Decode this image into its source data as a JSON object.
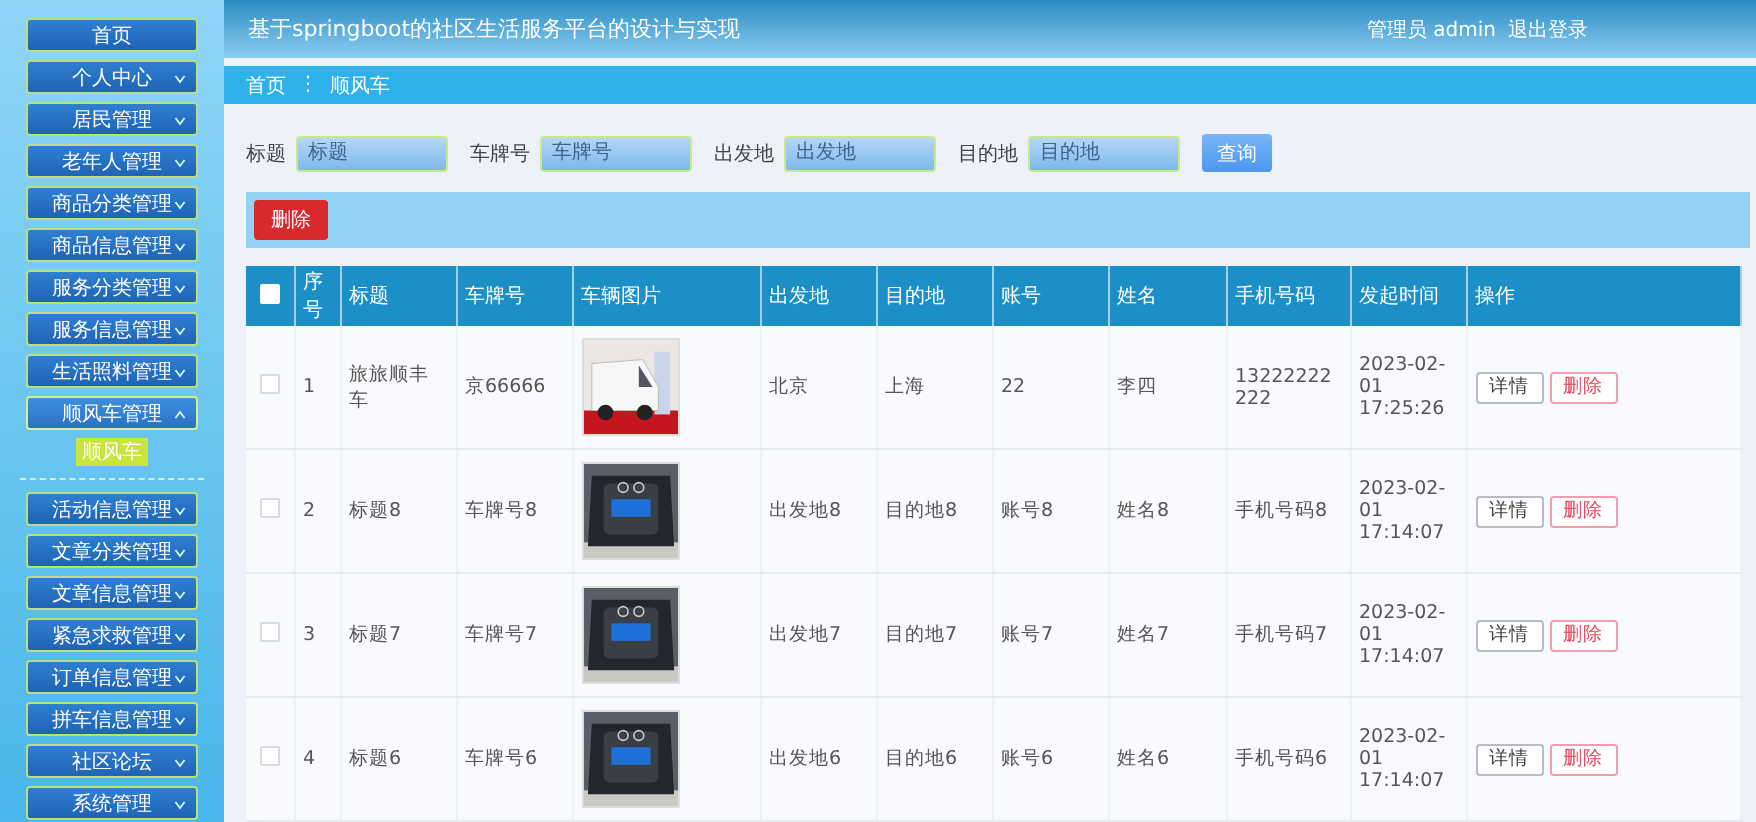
{
  "header": {
    "title": "基于springboot的社区生活服务平台的设计与实现",
    "user": "管理员 admin",
    "logout": "退出登录"
  },
  "sidebar": {
    "items": [
      {
        "label": "首页",
        "kind": "link"
      },
      {
        "label": "个人中心",
        "kind": "menu",
        "expanded": false
      },
      {
        "label": "居民管理",
        "kind": "menu",
        "expanded": false
      },
      {
        "label": "老年人管理",
        "kind": "menu",
        "expanded": false
      },
      {
        "label": "商品分类管理",
        "kind": "menu",
        "expanded": false
      },
      {
        "label": "商品信息管理",
        "kind": "menu",
        "expanded": false
      },
      {
        "label": "服务分类管理",
        "kind": "menu",
        "expanded": false
      },
      {
        "label": "服务信息管理",
        "kind": "menu",
        "expanded": false
      },
      {
        "label": "生活照料管理",
        "kind": "menu",
        "expanded": false
      },
      {
        "label": "顺风车管理",
        "kind": "menu",
        "expanded": true,
        "children": [
          {
            "label": "顺风车",
            "selected": true
          }
        ]
      },
      {
        "label": "活动信息管理",
        "kind": "menu",
        "expanded": false
      },
      {
        "label": "文章分类管理",
        "kind": "menu",
        "expanded": false
      },
      {
        "label": "文章信息管理",
        "kind": "menu",
        "expanded": false
      },
      {
        "label": "紧急求救管理",
        "kind": "menu",
        "expanded": false
      },
      {
        "label": "订单信息管理",
        "kind": "menu",
        "expanded": false
      },
      {
        "label": "拼车信息管理",
        "kind": "menu",
        "expanded": false
      },
      {
        "label": "社区论坛",
        "kind": "menu",
        "expanded": false
      },
      {
        "label": "系统管理",
        "kind": "menu",
        "expanded": false
      }
    ]
  },
  "breadcrumb": [
    "首页",
    "⋮",
    "顺风车"
  ],
  "search": {
    "fields": [
      {
        "label": "标题",
        "placeholder": "标题"
      },
      {
        "label": "车牌号",
        "placeholder": "车牌号"
      },
      {
        "label": "出发地",
        "placeholder": "出发地"
      },
      {
        "label": "目的地",
        "placeholder": "目的地"
      }
    ],
    "button": "查询"
  },
  "toolbar": {
    "delete_button": "删除"
  },
  "table": {
    "select_all": false,
    "columns": [
      "序号",
      "标题",
      "车牌号",
      "车辆图片",
      "出发地",
      "目的地",
      "账号",
      "姓名",
      "手机号码",
      "发起时间",
      "操作"
    ],
    "rows": [
      {
        "checked": false,
        "cells": [
          "1",
          "旅旅顺丰车",
          "京66666",
          {
            "kind": "picture"
          },
          "北京",
          "上海",
          "22",
          "李四",
          "13222222222",
          "2023-02-01 17:25:26"
        ],
        "actions": [
          "详情",
          "删除"
        ]
      },
      {
        "checked": false,
        "cells": [
          "2",
          "标题8",
          "车牌号8",
          {
            "kind": "picture"
          },
          "出发地8",
          "目的地8",
          "账号8",
          "姓名8",
          "手机号码8",
          "2023-02-01 17:14:07"
        ],
        "actions": [
          "详情",
          "删除"
        ]
      },
      {
        "checked": false,
        "cells": [
          "3",
          "标题7",
          "车牌号7",
          {
            "kind": "picture"
          },
          "出发地7",
          "目的地7",
          "账号7",
          "姓名7",
          "手机号码7",
          "2023-02-01 17:14:07"
        ],
        "actions": [
          "详情",
          "删除"
        ]
      },
      {
        "checked": false,
        "cells": [
          "4",
          "标题6",
          "车牌号6",
          {
            "kind": "picture"
          },
          "出发地6",
          "目的地6",
          "账号6",
          "姓名6",
          "手机号码6",
          "2023-02-01 17:14:07"
        ],
        "actions": [
          "详情",
          "删除"
        ]
      }
    ]
  }
}
